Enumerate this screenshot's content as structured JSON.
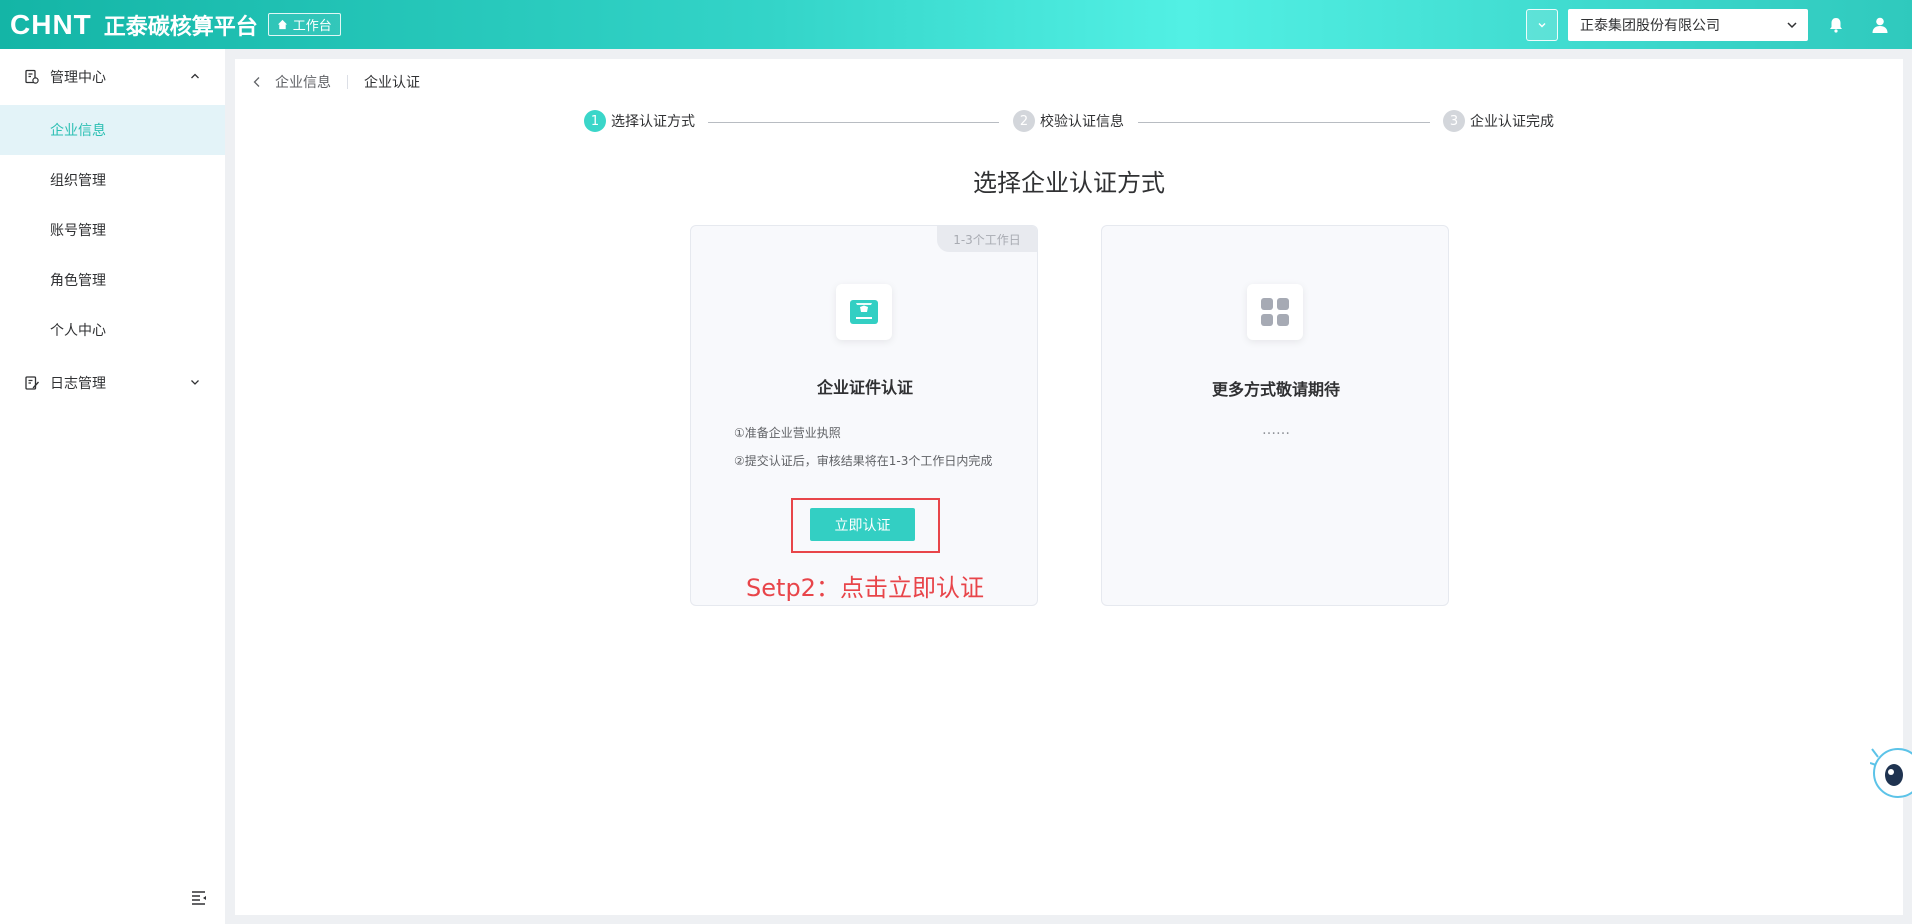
{
  "header": {
    "logo": "CHNT",
    "platform_name": "正泰碳核算平台",
    "workbench_label": "工作台",
    "company": "正泰集团股份有限公司"
  },
  "sidebar": {
    "groups": [
      {
        "label": "管理中心",
        "expanded": true
      },
      {
        "label": "日志管理",
        "expanded": false
      }
    ],
    "items": [
      {
        "label": "企业信息",
        "active": true
      },
      {
        "label": "组织管理",
        "active": false
      },
      {
        "label": "账号管理",
        "active": false
      },
      {
        "label": "角色管理",
        "active": false
      },
      {
        "label": "个人中心",
        "active": false
      }
    ]
  },
  "breadcrumb": {
    "parent": "企业信息",
    "current": "企业认证"
  },
  "steps": [
    {
      "num": "1",
      "label": "选择认证方式",
      "active": true
    },
    {
      "num": "2",
      "label": "校验认证信息",
      "active": false
    },
    {
      "num": "3",
      "label": "企业认证完成",
      "active": false
    }
  ],
  "main": {
    "heading": "选择企业认证方式",
    "cards": [
      {
        "badge": "1-3个工作日",
        "icon": "certificate-icon",
        "title": "企业证件认证",
        "desc": [
          "①准备企业营业执照",
          "②提交认证后，审核结果将在1-3个工作日内完成"
        ],
        "button": "立即认证",
        "annotation": "Setp2：点击立即认证"
      },
      {
        "icon": "grid-icon",
        "title": "更多方式敬请期待",
        "dots": "……"
      }
    ]
  },
  "colors": {
    "accent": "#33cfc3",
    "annotation_red": "#e8454a",
    "active_menu_bg": "#e3f3f8"
  }
}
